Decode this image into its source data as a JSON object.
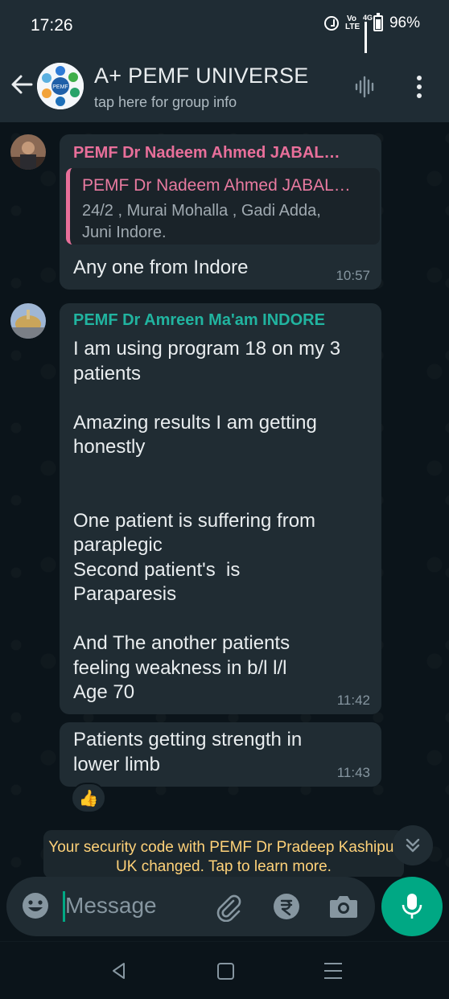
{
  "status_bar": {
    "time": "17:26",
    "network_label": "4G",
    "volte_label": "Vo\nLTE",
    "battery_percent": "96%"
  },
  "header": {
    "title": "A+ PEMF UNIVERSE",
    "subtitle": "tap here for group info",
    "avatar_label": "PEMF"
  },
  "messages": [
    {
      "sender": "PEMF Dr Nadeem Ahmed JABAL…",
      "sender_color": "#e86f9a",
      "quote": {
        "sender": "PEMF Dr Nadeem Ahmed JABAL…",
        "text": "24/2 , Murai Mohalla , Gadi Adda,\nJuni Indore."
      },
      "text": "Any one from Indore",
      "time": "10:57"
    },
    {
      "sender": "PEMF Dr Amreen Ma'am INDORE",
      "sender_color": "#21b4a0",
      "text": "I am using program 18 on my 3\npatients\n\nAmazing results I am getting\nhonestly\n\n\nOne patient is suffering from\nparaplegic\nSecond patient's  is\nParaparesis\n\nAnd The another patients\nfeeling weakness in b/l l/l\nAge 70",
      "time": "11:42"
    },
    {
      "text": "Patients getting strength in\nlower limb",
      "time": "11:43",
      "reaction": "👍"
    }
  ],
  "system_note": "Your security code with PEMF Dr Pradeep Kashipur UK changed. Tap to learn more.",
  "input": {
    "placeholder": "Message"
  },
  "colors": {
    "accent": "#00a884",
    "bubble": "#202c33",
    "background": "#0b141a",
    "header": "#1f2c34"
  }
}
